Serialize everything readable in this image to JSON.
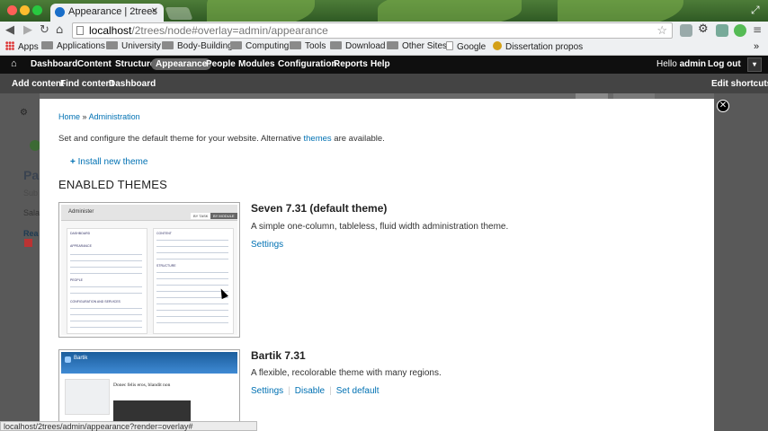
{
  "browser": {
    "tab_title": "Appearance | 2trees",
    "url_host": "localhost",
    "url_path": "/2trees/node#overlay=admin/appearance",
    "status_url": "localhost/2trees/admin/appearance?render=overlay#"
  },
  "bookmarks": [
    {
      "label": "Apps",
      "icon": "apps-grid-icon"
    },
    {
      "label": "Applications",
      "icon": "folder-icon"
    },
    {
      "label": "University",
      "icon": "folder-icon"
    },
    {
      "label": "Body-Building",
      "icon": "folder-icon"
    },
    {
      "label": "Computing",
      "icon": "folder-icon"
    },
    {
      "label": "Tools",
      "icon": "folder-icon"
    },
    {
      "label": "Download",
      "icon": "folder-icon"
    },
    {
      "label": "Other Sites",
      "icon": "folder-icon"
    },
    {
      "label": "Google",
      "icon": "page-icon"
    },
    {
      "label": "Dissertation propos",
      "icon": "scholar-icon"
    }
  ],
  "admin_toolbar": {
    "menu": [
      "Dashboard",
      "Content",
      "Structure",
      "Appearance",
      "People",
      "Modules",
      "Configuration",
      "Reports",
      "Help"
    ],
    "active": "Appearance",
    "greeting": "Hello",
    "username": "admin",
    "logout": "Log out"
  },
  "shortcuts": {
    "items": [
      "Add content",
      "Find content",
      "Dashboard"
    ],
    "edit": "Edit shortcuts"
  },
  "background_page": {
    "title_fragment": "Pa",
    "lines": [
      "Sub",
      "Sala",
      "Rea"
    ]
  },
  "overlay": {
    "breadcrumb_home": "Home",
    "breadcrumb_sep": "»",
    "breadcrumb_admin": "Administration",
    "intro_before": "Set and configure the default theme for your website. Alternative",
    "intro_link": "themes",
    "intro_after": "are available.",
    "install_link": "Install new theme",
    "enabled_heading": "ENABLED THEMES",
    "themes": [
      {
        "name": "Seven 7.31 (default theme)",
        "description": "A simple one-column, tableless, fluid width administration theme.",
        "links": [
          "Settings"
        ]
      },
      {
        "name": "Bartik 7.31",
        "description": "A flexible, recolorable theme with many regions.",
        "links": [
          "Settings",
          "Disable",
          "Set default"
        ]
      }
    ],
    "seven_preview": {
      "header": "Administer",
      "tab1": "BY TASK",
      "tab2": "BY MODULE",
      "sections": [
        "DASHBOARD",
        "APPEARANCE",
        "PEOPLE",
        "CONFIGURATION AND SERVICES",
        "CONTENT",
        "STRUCTURE"
      ]
    },
    "bartik_preview": {
      "site_name": "Bartik",
      "article_title": "Donec felis eros, blandit non"
    }
  },
  "colors": {
    "link": "#0071b3",
    "toolbar_bg": "#0f0f0f",
    "shortcut_bg": "#444444",
    "dim_bg": "#595959"
  }
}
